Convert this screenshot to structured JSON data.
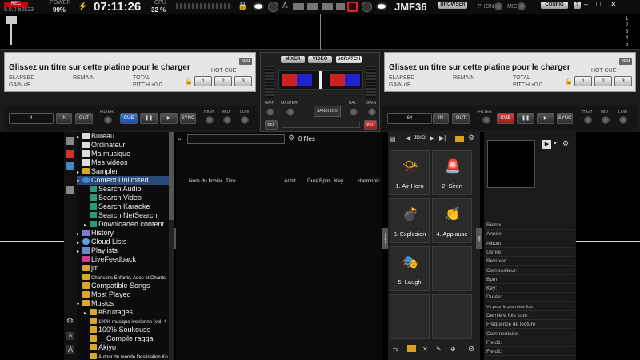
{
  "topbar": {
    "rec_badge": "REC",
    "version": "8.0.0 b2523",
    "power_label": "POWER",
    "power_value": "99%",
    "clock": "07:11:26",
    "cpu_label": "CPU",
    "cpu_value": "32 %",
    "a_label": "A",
    "user": "JMF36",
    "browser_btn": "BROWSER",
    "phone_label": "PHONE",
    "mic_label": "MIC",
    "config_btn": "CONFIG",
    "win_min": "–",
    "win_max": "□",
    "win_close": "✕"
  },
  "deck_left": {
    "title": "Glissez un titre sur cette platine pour le charger",
    "elapsed": "ELAPSED",
    "remain": "REMAIN",
    "total": "TOTAL",
    "gain": "GAIN dB",
    "pitch": "PITCH +0.0",
    "bpm": "BPM",
    "hotcue_label": "HOT CUE",
    "hotcues": [
      "1",
      "2",
      "3"
    ],
    "loop_value": "4",
    "in": "IN",
    "out": "OUT",
    "filter": "FILTER",
    "cue": "CUE",
    "play": "▶",
    "pause": "❚❚",
    "sync": "SYNC",
    "high": "HIGH",
    "mid": "MID",
    "low": "LOW"
  },
  "deck_right": {
    "title": "Glissez un titre sur cette platine pour le charger",
    "elapsed": "ELAPSED",
    "remain": "REMAIN",
    "total": "TOTAL",
    "gain": "GAIN dB",
    "pitch": "PITCH +0.0",
    "bpm": "BPM",
    "hotcue_label": "HOT CUE",
    "hotcues": [
      "1",
      "2",
      "3"
    ],
    "loop_value": "64",
    "in": "IN",
    "out": "OUT",
    "filter": "FILTER",
    "cue": "CUE",
    "play": "▶",
    "pause": "❚❚",
    "sync": "SYNC",
    "high": "HIGH",
    "mid": "MID",
    "low": "LOW"
  },
  "mixer": {
    "tabs": [
      "MIXER",
      "VIDEO",
      "SCRATCH"
    ],
    "gain_l": "GAIN",
    "gain_r": "GAIN",
    "master": "MASTER",
    "bal": "BAL",
    "logo": "SANDISCO",
    "pfl_l": "PFL",
    "pfl_r": "PFL"
  },
  "browser": {
    "items": [
      {
        "label": "Bureau",
        "icon": "file"
      },
      {
        "label": "Ordinateur",
        "icon": "file"
      },
      {
        "label": "Ma musique",
        "icon": "file"
      },
      {
        "label": "Mes vidéos",
        "icon": "file"
      },
      {
        "label": "Sampler",
        "icon": "folder"
      },
      {
        "label": "Content Unlimited",
        "icon": "cu"
      },
      {
        "label": "Search Audio",
        "icon": "sa"
      },
      {
        "label": "Search Video",
        "icon": "sa"
      },
      {
        "label": "Search Karaoke",
        "icon": "sa"
      },
      {
        "label": "Search NetSearch",
        "icon": "sa"
      },
      {
        "label": "Downloaded content",
        "icon": "sa"
      },
      {
        "label": "History",
        "icon": "hist"
      },
      {
        "label": "Cloud Lists",
        "icon": "cloud"
      },
      {
        "label": "Playlists",
        "icon": "pl"
      },
      {
        "label": "LiveFeedback",
        "icon": "lf"
      },
      {
        "label": "jm",
        "icon": "folder"
      },
      {
        "label": "Chansons Enfants, Ados et Chants",
        "icon": "folder"
      },
      {
        "label": "Compatible Songs",
        "icon": "folder"
      },
      {
        "label": "Most Played",
        "icon": "folder"
      },
      {
        "label": "Musics",
        "icon": "folder"
      },
      {
        "label": "#Bruitages",
        "icon": "folder"
      },
      {
        "label": "100% musique ivoirienne (vol. 4",
        "icon": "folder"
      },
      {
        "label": "100% Soukouss",
        "icon": "folder"
      },
      {
        "label": "__Compile ragga",
        "icon": "folder"
      },
      {
        "label": "Akiyo",
        "icon": "folder"
      },
      {
        "label": "Autour du monde Destination Ko",
        "icon": "folder"
      }
    ]
  },
  "filelist": {
    "search_placeholder": "",
    "count": "0 files",
    "columns": [
      "Nom du fichier",
      "Titre",
      "Artist",
      "Durée",
      "Bpm",
      "Key",
      "Harmonic"
    ]
  },
  "sampler": {
    "bank": "JDIO",
    "pads": [
      {
        "label": "1. Air Horn",
        "icon": "📯"
      },
      {
        "label": "2. Siren",
        "icon": "🚨"
      },
      {
        "label": "3. Explosion",
        "icon": "💣"
      },
      {
        "label": "4. Applause",
        "icon": "👏"
      },
      {
        "label": "5. Laugh",
        "icon": "🎭"
      }
    ],
    "side_tab": "sampler"
  },
  "info": {
    "side_tab": "info",
    "fields": [
      "Remix:",
      "Année:",
      "Album:",
      "Genre:",
      "Remixer:",
      "Compositeur:",
      "Bpm:",
      "Key:",
      "Durée:",
      "Vu pour la première fois",
      "Dernière fois joué:",
      "Fréquence de lecture",
      "Commentaire:",
      "Field1:",
      "Field2:"
    ]
  },
  "folders_tab": "folders",
  "font_a_small": "A",
  "font_a_big": "A",
  "colors": {
    "accent": "#3a7ee0",
    "cue_red": "#e04040",
    "panel": "#1f1f1f"
  }
}
